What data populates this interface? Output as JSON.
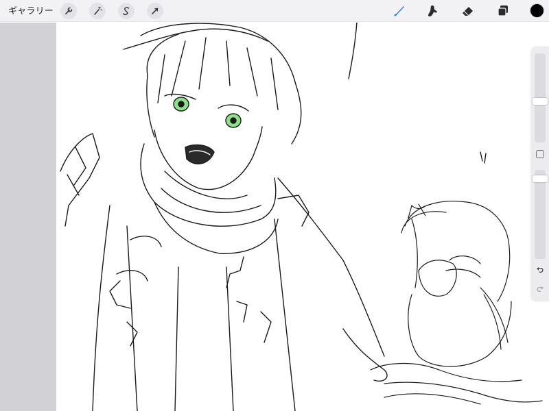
{
  "topbar": {
    "gallery_label": "ギャラリー",
    "left_tools": [
      {
        "name": "wrench-icon"
      },
      {
        "name": "magic-wand-icon"
      },
      {
        "name": "selection-icon"
      },
      {
        "name": "transform-arrow-icon"
      }
    ],
    "right_tools": [
      {
        "name": "brush-icon",
        "active": true
      },
      {
        "name": "smudge-icon",
        "active": false
      },
      {
        "name": "eraser-icon",
        "active": false
      },
      {
        "name": "layers-icon",
        "active": false
      }
    ],
    "active_color": "#000000",
    "accent_color": "#2f7bf6"
  },
  "sidebar": {
    "brush_size_level": 0.2,
    "opacity_level": 0.05,
    "controls": [
      "brush-size-slider",
      "modify-button",
      "opacity-slider",
      "undo-button",
      "redo-button"
    ]
  }
}
